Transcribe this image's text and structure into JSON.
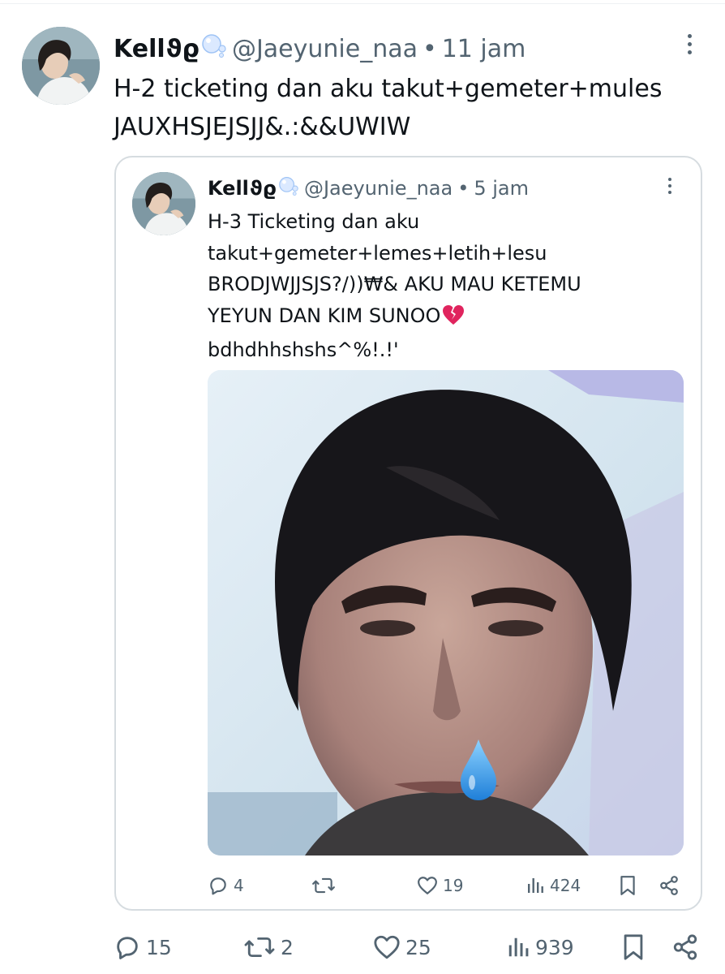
{
  "tweet": {
    "author_name": "Kell",
    "author_name_deco": "ϑϱ",
    "handle": "@Jaeyunie_naa",
    "separator": "•",
    "time": "11 jam",
    "text": "H-2 ticketing dan aku takut+gemeter+mules\nJAUXHSJEJSJJ&.:&&UWIW",
    "avatar_icon": "profile-photo",
    "stats": {
      "replies": "15",
      "reposts": "2",
      "likes": "25",
      "views": "939"
    }
  },
  "quoted_tweet": {
    "author_name": "Kell",
    "author_name_deco": "ϑϱ",
    "handle": "@Jaeyunie_naa",
    "separator": "•",
    "time": "5 jam",
    "text_lines": [
      "H-3 Ticketing dan aku",
      "takut+gemeter+lemes+letih+lesu",
      "BRODJWJJSJS?/))₩& AKU MAU KETEMU",
      "YEYUN DAN KIM SUNOO",
      "bdhdhhshshs^%!.!'"
    ],
    "emoji": "broken-heart-icon",
    "media": "selfie-photo-with-sweat-drop",
    "stats": {
      "replies": "4",
      "reposts": "",
      "likes": "19",
      "views": "424"
    }
  },
  "colors": {
    "text_primary": "#0f1419",
    "text_secondary": "#536471",
    "card_border": "#d6dce0",
    "broken_heart": "#e0245e",
    "sweat_drop": "#3b9bea"
  }
}
